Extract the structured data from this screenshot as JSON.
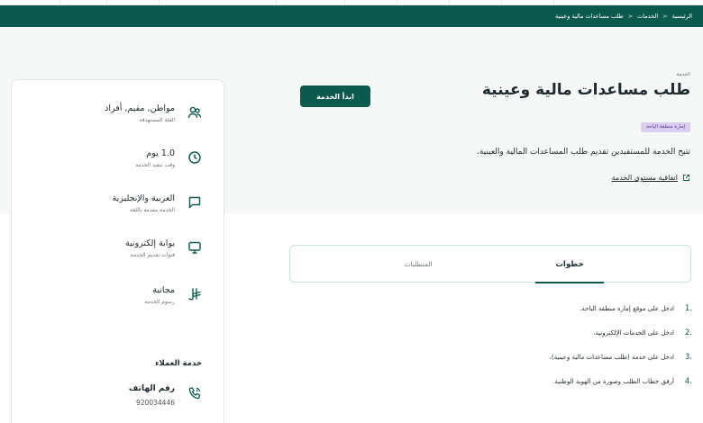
{
  "breadcrumb": {
    "home": "الرئيسية",
    "services": "الخدمات",
    "current": "طلب مساعدات مالية وعينية",
    "separator": ">"
  },
  "service": {
    "label": "الخدمة",
    "title": "طلب مساعدات مالية وعينية",
    "badge": "إمارة منطقة الباحة",
    "description": "تتيح الخدمة للمستفيدين تقديم طلب المساعدات المالية والعينية.",
    "sla_link": "اتفاقية مستوى الخدمة",
    "start_button": "ابدأ الخدمة"
  },
  "info": [
    {
      "icon": "users-icon",
      "value": "مواطن, مقيم, أفراد",
      "label": "الفئة المستهدفة"
    },
    {
      "icon": "clock-icon",
      "value": "1.0 يوم",
      "label": "وقت تنفيذ الخدمة"
    },
    {
      "icon": "chat-icon",
      "value": "العربية والإنجليزية",
      "label": "الخدمة مقدمة باللغة"
    },
    {
      "icon": "monitor-icon",
      "value": "بوابة إلكترونية",
      "label": "قنوات تقديم الخدمة"
    },
    {
      "icon": "riyal-icon",
      "value": "مجانية",
      "label": "رسوم الخدمة"
    }
  ],
  "customer_service": {
    "title": "خدمة العملاء",
    "phone_label": "رقم الهاتف",
    "phone_value": "920034446"
  },
  "tabs": {
    "steps": "خطوات",
    "requirements": "المتطلبات"
  },
  "steps": [
    {
      "num": "1.",
      "text": "ادخل على موقع إمارة منطقة الباحة."
    },
    {
      "num": "2.",
      "text": "ادخل على الخدمات الإلكترونية."
    },
    {
      "num": "3.",
      "text": "ادخل على خدمة (طلب مساعدات مالية وعينية)."
    },
    {
      "num": "4.",
      "text": "أرفق خطاب الطلب وصورة من الهوية الوطنية."
    }
  ],
  "colors": {
    "primary": "#0c5a4e",
    "hero_bg": "#f6f7f7",
    "badge_bg": "#d9cdf0",
    "badge_text": "#5b3f99"
  }
}
